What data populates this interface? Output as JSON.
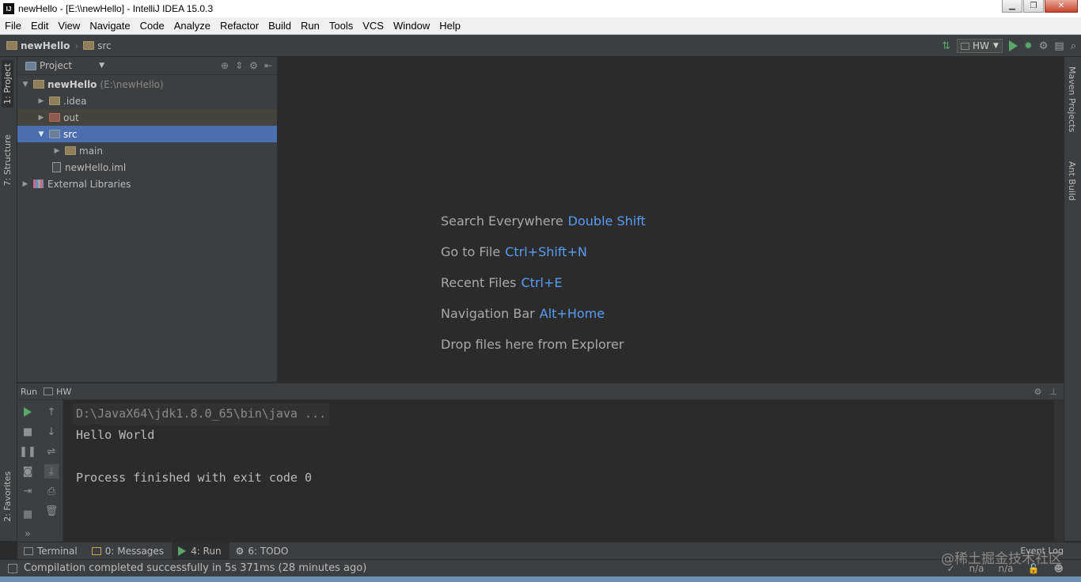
{
  "window": {
    "title": "newHello - [E:\\\\newHello] - IntelliJ IDEA 15.0.3",
    "app_icon": "IJ"
  },
  "menu": [
    "File",
    "Edit",
    "View",
    "Navigate",
    "Code",
    "Analyze",
    "Refactor",
    "Build",
    "Run",
    "Tools",
    "VCS",
    "Window",
    "Help"
  ],
  "navbar": {
    "project": "newHello",
    "folder": "src",
    "run_config": "HW"
  },
  "left_strip": {
    "project_tab": "1: Project",
    "structure_tab": "7: Structure",
    "favorites_tab": "2: Favorites"
  },
  "right_strip": {
    "maven_tab": "Maven Projects",
    "ant_tab": "Ant Build"
  },
  "project_panel": {
    "view": "Project",
    "root_name": "newHello",
    "root_path": "(E:\\newHello)",
    "items": [
      {
        "label": ".idea"
      },
      {
        "label": "out"
      },
      {
        "label": "src"
      },
      {
        "label": "main"
      },
      {
        "label": "newHello.iml"
      },
      {
        "label": "External Libraries"
      }
    ]
  },
  "editor": {
    "hints": [
      {
        "text": "Search Everywhere",
        "key": "Double Shift"
      },
      {
        "text": "Go to File",
        "key": "Ctrl+Shift+N"
      },
      {
        "text": "Recent Files",
        "key": "Ctrl+E"
      },
      {
        "text": "Navigation Bar",
        "key": "Alt+Home"
      },
      {
        "text": "Drop files here from Explorer",
        "key": ""
      }
    ]
  },
  "run_panel": {
    "label": "Run",
    "config": "HW",
    "console": [
      "D:\\JavaX64\\jdk1.8.0_65\\bin\\java ...",
      "Hello World",
      "",
      "Process finished with exit code 0"
    ]
  },
  "bottom_tabs": [
    {
      "label": "Terminal"
    },
    {
      "label": "0: Messages"
    },
    {
      "label": "4: Run"
    },
    {
      "label": "6: TODO"
    }
  ],
  "event_log": "Event Log",
  "status": {
    "message": "Compilation completed successfully in 5s 371ms (28 minutes ago)",
    "pos1": "n/a",
    "pos2": "n/a"
  },
  "watermark": "@稀土掘金技术社区",
  "colors": {
    "accent_blue": "#589df6",
    "selection": "#4b6eaf",
    "run_green": "#59a869",
    "background": "#2b2b2b"
  }
}
